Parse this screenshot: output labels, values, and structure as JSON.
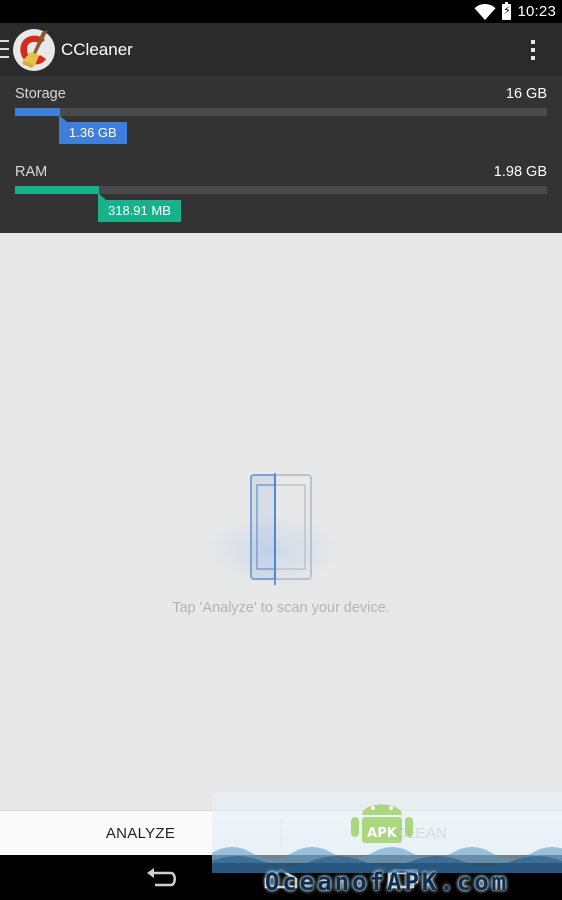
{
  "status_bar": {
    "time": "10:23",
    "icons": [
      "wifi-icon",
      "battery-charging-icon"
    ],
    "battery_level": 1.0
  },
  "action_bar": {
    "title": "CCleaner",
    "icons": [
      "menu-icon",
      "ccleaner-logo",
      "overflow-menu-icon"
    ]
  },
  "storage": {
    "label": "Storage",
    "total": "16 GB",
    "used": "1.36 GB",
    "used_fraction": 0.085,
    "color": "#3f7fd9"
  },
  "ram": {
    "label": "RAM",
    "total": "1.98 GB",
    "used": "318.91 MB",
    "used_fraction": 0.157,
    "color": "#18b28a"
  },
  "main": {
    "hint": "Tap 'Analyze' to scan your device.",
    "icon": "device-scan-icon"
  },
  "buttons": {
    "analyze": "ANALYZE",
    "clean": "CLEAN"
  },
  "nav_bar": {
    "icons": [
      "back-icon",
      "home-icon",
      "recents-icon"
    ]
  },
  "watermark": {
    "text": "OceanofAPK.com",
    "logo_text": "APK"
  },
  "colors": {
    "action_bar": "#2b2b2b",
    "stats_panel": "#333333",
    "main_bg": "#e8e8e8"
  }
}
